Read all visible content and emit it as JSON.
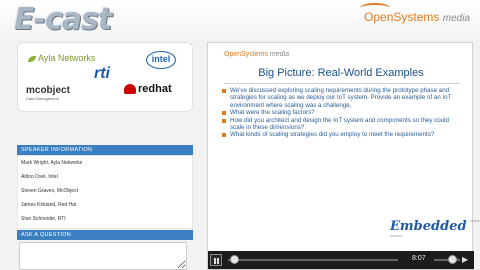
{
  "header": {
    "app_title": "E-cast",
    "brand_main": "OpenSystems",
    "brand_sub": "media"
  },
  "sponsors": [
    {
      "name": "Ayla Networks"
    },
    {
      "name": "intel"
    },
    {
      "name": "rti"
    },
    {
      "name": "mcobject",
      "tagline": "Data Management"
    },
    {
      "name": "redhat"
    }
  ],
  "speaker_section": {
    "title": "SPEAKER INFORMATION",
    "speakers": [
      "Mark Wright, Ayla Networks",
      "Aldoo Osel, Intel",
      "Steven Graves, McObject",
      "James Kirkland, Red Hat",
      "Stan Schneider, RTI"
    ]
  },
  "ask_section": {
    "title": "ASK A QUESTION"
  },
  "slide": {
    "logo_main": "OpenSystems",
    "logo_sub": "media",
    "title": "Big Picture: Real-World Examples",
    "bullets": [
      "We've discussed exploring scaling requirements during the prototype phase and strategies for scaling as we deploy our IoT system. Provide an example of an IoT environment where scaling was a challenge.",
      "What were the scaling factors?",
      "How did you architect and design the IoT system and components so they could scale in these dimensions?",
      "What kinds of scaling strategies did you employ to meet the requirements?"
    ],
    "footer_logo": "Embedded",
    "footer_logo_sub": "COMPUTING DESIGN"
  },
  "player": {
    "time": "8:07",
    "progress": 0.02,
    "volume": 0.7
  }
}
